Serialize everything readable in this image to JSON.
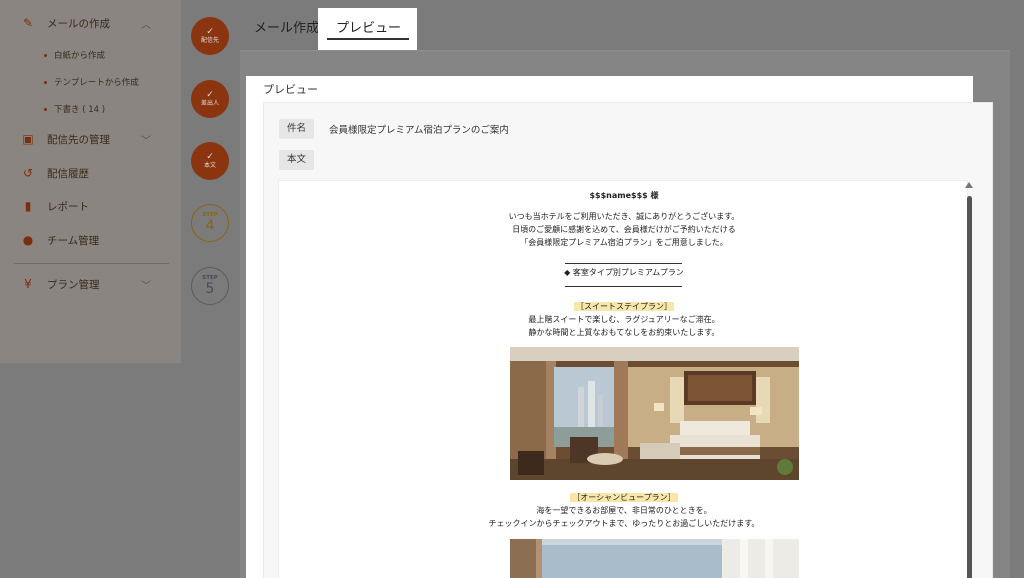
{
  "sidebar": {
    "compose": {
      "label": "メールの作成",
      "icon": "pencil-icon"
    },
    "compose_sub": [
      {
        "label": "白紙から作成"
      },
      {
        "label": "テンプレートから作成"
      },
      {
        "label": "下書き ( 14 )"
      }
    ],
    "recipients": {
      "label": "配信先の管理",
      "icon": "contact-card-icon"
    },
    "history": {
      "label": "配信履歴",
      "icon": "history-icon"
    },
    "report": {
      "label": "レポート",
      "icon": "bar-chart-icon"
    },
    "team": {
      "label": "チーム管理",
      "icon": "team-icon"
    },
    "plan": {
      "label": "プラン管理",
      "icon": "yen-icon"
    }
  },
  "steps": [
    {
      "label": "配信先",
      "state": "done"
    },
    {
      "label": "差出人",
      "state": "done"
    },
    {
      "label": "本文",
      "state": "done"
    },
    {
      "word": "STEP",
      "number": "4",
      "state": "current"
    },
    {
      "word": "STEP",
      "number": "5",
      "state": "todo"
    }
  ],
  "tabs": {
    "compose": "メール作成",
    "preview": "プレビュー"
  },
  "modal": {
    "title": "プレビュー",
    "subject_label": "件名",
    "subject_value": "会員様限定プレミアム宿泊プランのご案内",
    "body_label": "本文"
  },
  "email": {
    "greeting": "$$$name$$$ 様",
    "intro": [
      "いつも当ホテルをご利用いただき、誠にありがとうございます。",
      "日頃のご愛顧に感謝を込めて、会員様だけがご予約いただける",
      "「会員様限定プレミアム宿泊プラン」をご用意しました。"
    ],
    "section_heading": "◆ 客室タイプ別プレミアムプラン",
    "plans": [
      {
        "title": "［スイートステイプラン］",
        "lines": [
          "最上階スイートで楽しむ、ラグジュアリーなご滞在。",
          "静かな時間と上質なおもてなしをお約束いたします。"
        ]
      },
      {
        "title": "［オーシャンビュープラン］",
        "lines": [
          "海を一望できるお部屋で、非日常のひとときを。",
          "チェックインからチェックアウトまで、ゆったりとお過ごしいただけます。"
        ]
      }
    ]
  },
  "colors": {
    "accent": "#d24a12",
    "step_current": "#d4a017",
    "highlight": "#f7e7a8"
  }
}
